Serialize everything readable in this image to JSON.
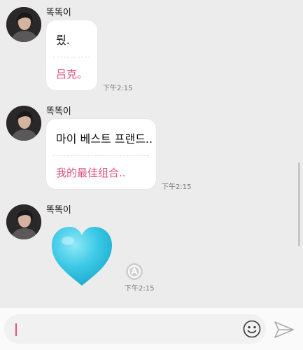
{
  "messages": [
    {
      "sender": "똑똑이",
      "original": "뤘.",
      "translation": "吕克。",
      "time": "下午2:15"
    },
    {
      "sender": "똑똑이",
      "original": "마이 베스트 프랜드..",
      "translation": "我的最佳组合..",
      "time": "下午2:15"
    },
    {
      "sender": "똑똑이",
      "sticker": "blue-heart",
      "time": "下午2:15"
    }
  ],
  "input": {
    "placeholder": ""
  },
  "colors": {
    "accent": "#e0507a",
    "heart": "#3cc9e6"
  }
}
